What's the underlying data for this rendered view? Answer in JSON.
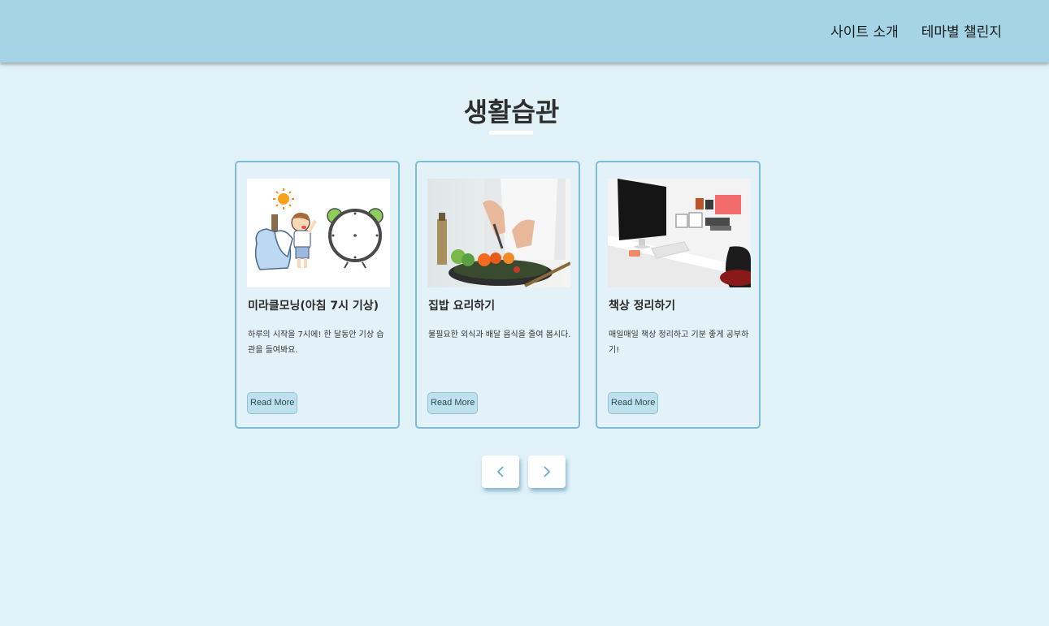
{
  "header": {
    "nav": [
      {
        "label": "사이트 소개"
      },
      {
        "label": "테마별 챌린지"
      }
    ],
    "background": "#a5d4e7"
  },
  "section": {
    "title": "생활습관"
  },
  "cards": [
    {
      "image": "morning-wakeup-illustration",
      "title": "미라클모닝(아침 7시 기상)",
      "description": "하루의 시작을 7시에! 한 달동안 기상 습관을 들여봐요.",
      "button": "Read More"
    },
    {
      "image": "home-cooking-photo",
      "title": "집밥 요리하기",
      "description": "불필요한 외식과 배달 음식을 줄여 봅시다.",
      "button": "Read More"
    },
    {
      "image": "tidy-desk-photo",
      "title": "책상 정리하기",
      "description": "매일매일 책상 정리하고 기분 좋게 공부하기!",
      "button": "Read More"
    }
  ],
  "pagination": {
    "prev_icon": "chevron-left-icon",
    "next_icon": "chevron-right-icon",
    "accent": "#6aaecb"
  }
}
